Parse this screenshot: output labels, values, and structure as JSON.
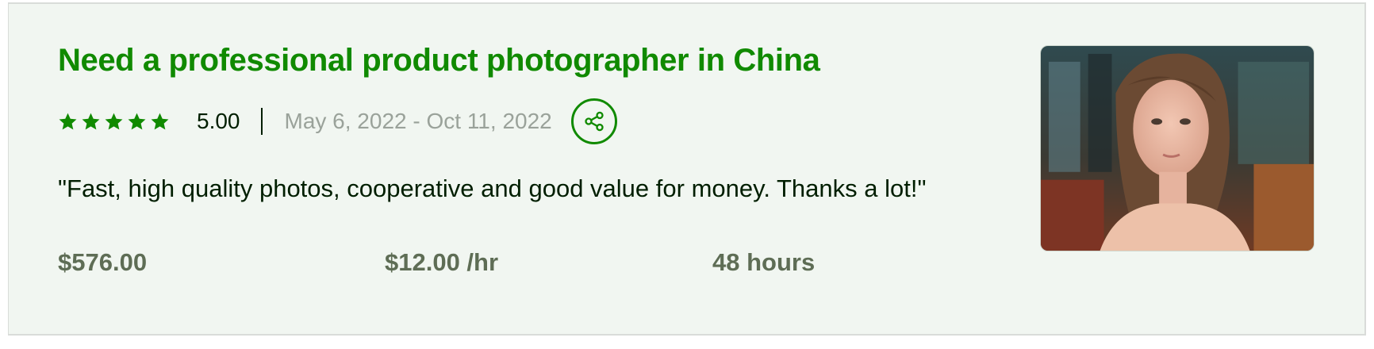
{
  "job": {
    "title": "Need a professional product photographer in China",
    "stars": 5,
    "rating": "5.00",
    "dates": "May 6, 2022 - Oct 11, 2022",
    "quote": "\"Fast, high quality photos, cooperative and good value for money. Thanks a lot!\"",
    "total": "$576.00",
    "rate": "$12.00 /hr",
    "hours": "48 hours"
  },
  "icons": {
    "star": "star-icon",
    "share": "share-icon"
  },
  "colors": {
    "accent": "#108a00",
    "card_bg": "#f1f6f1",
    "text": "#001e00",
    "muted": "#9aa29a",
    "stat": "#5e6d55"
  }
}
